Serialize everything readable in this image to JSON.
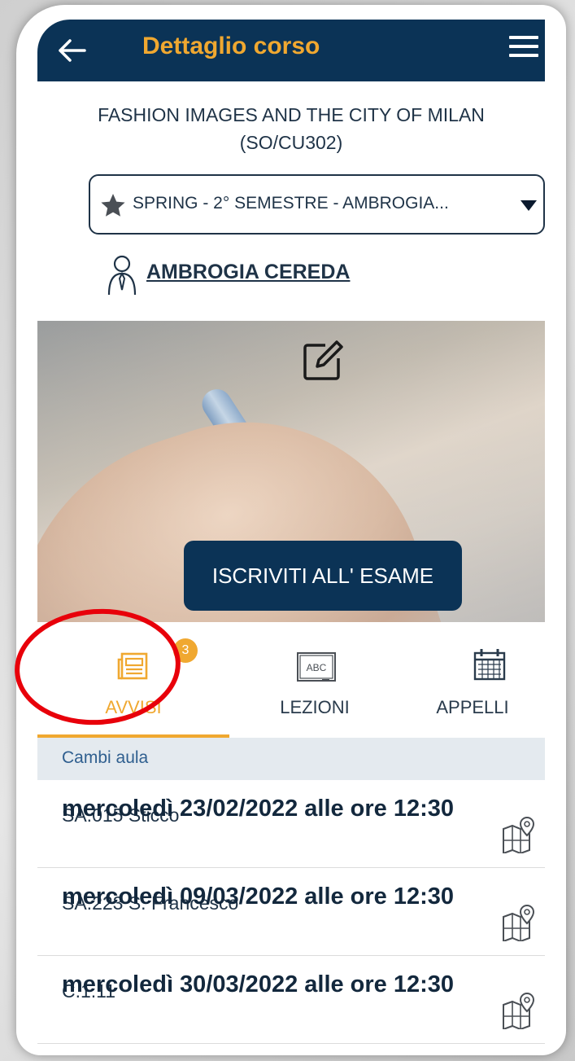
{
  "header": {
    "title": "Dettaglio corso",
    "back_icon": "arrow-left-icon",
    "menu_icon": "hamburger-menu-icon",
    "background": "#0b3356",
    "title_color": "#f0a830"
  },
  "course": {
    "title": "FASHION IMAGES AND THE CITY OF MILAN (SO/CU302)",
    "semester_selected": "SPRING - 2° SEMESTRE - AMBROGIA...",
    "teacher": "AMBROGIA CEREDA"
  },
  "banner": {
    "button_label": "ISCRIVITI ALL' ESAME",
    "edit_icon": "edit-pencil-icon"
  },
  "tabs": [
    {
      "label": "AVVISI",
      "icon": "newspaper-icon",
      "badge": "3",
      "active": true
    },
    {
      "label": "LEZIONI",
      "icon": "blackboard-abc-icon",
      "active": false
    },
    {
      "label": "APPELLI",
      "icon": "calendar-icon",
      "active": false
    }
  ],
  "section": {
    "title": "Cambi aula"
  },
  "room_changes": [
    {
      "date": "mercoledì 23/02/2022 alle ore 12:30",
      "room": "SA.015 Sticco",
      "icon": "map-pin-icon"
    },
    {
      "date": "mercoledì 09/03/2022 alle ore 12:30",
      "room": "SA.223 S. Francesco",
      "icon": "map-pin-icon"
    },
    {
      "date": "mercoledì 30/03/2022 alle ore 12:30",
      "room": "C.1.11",
      "icon": "map-pin-icon"
    }
  ],
  "colors": {
    "accent": "#f0a830",
    "primary": "#0b3356",
    "annotation_ring": "#e8000a"
  }
}
